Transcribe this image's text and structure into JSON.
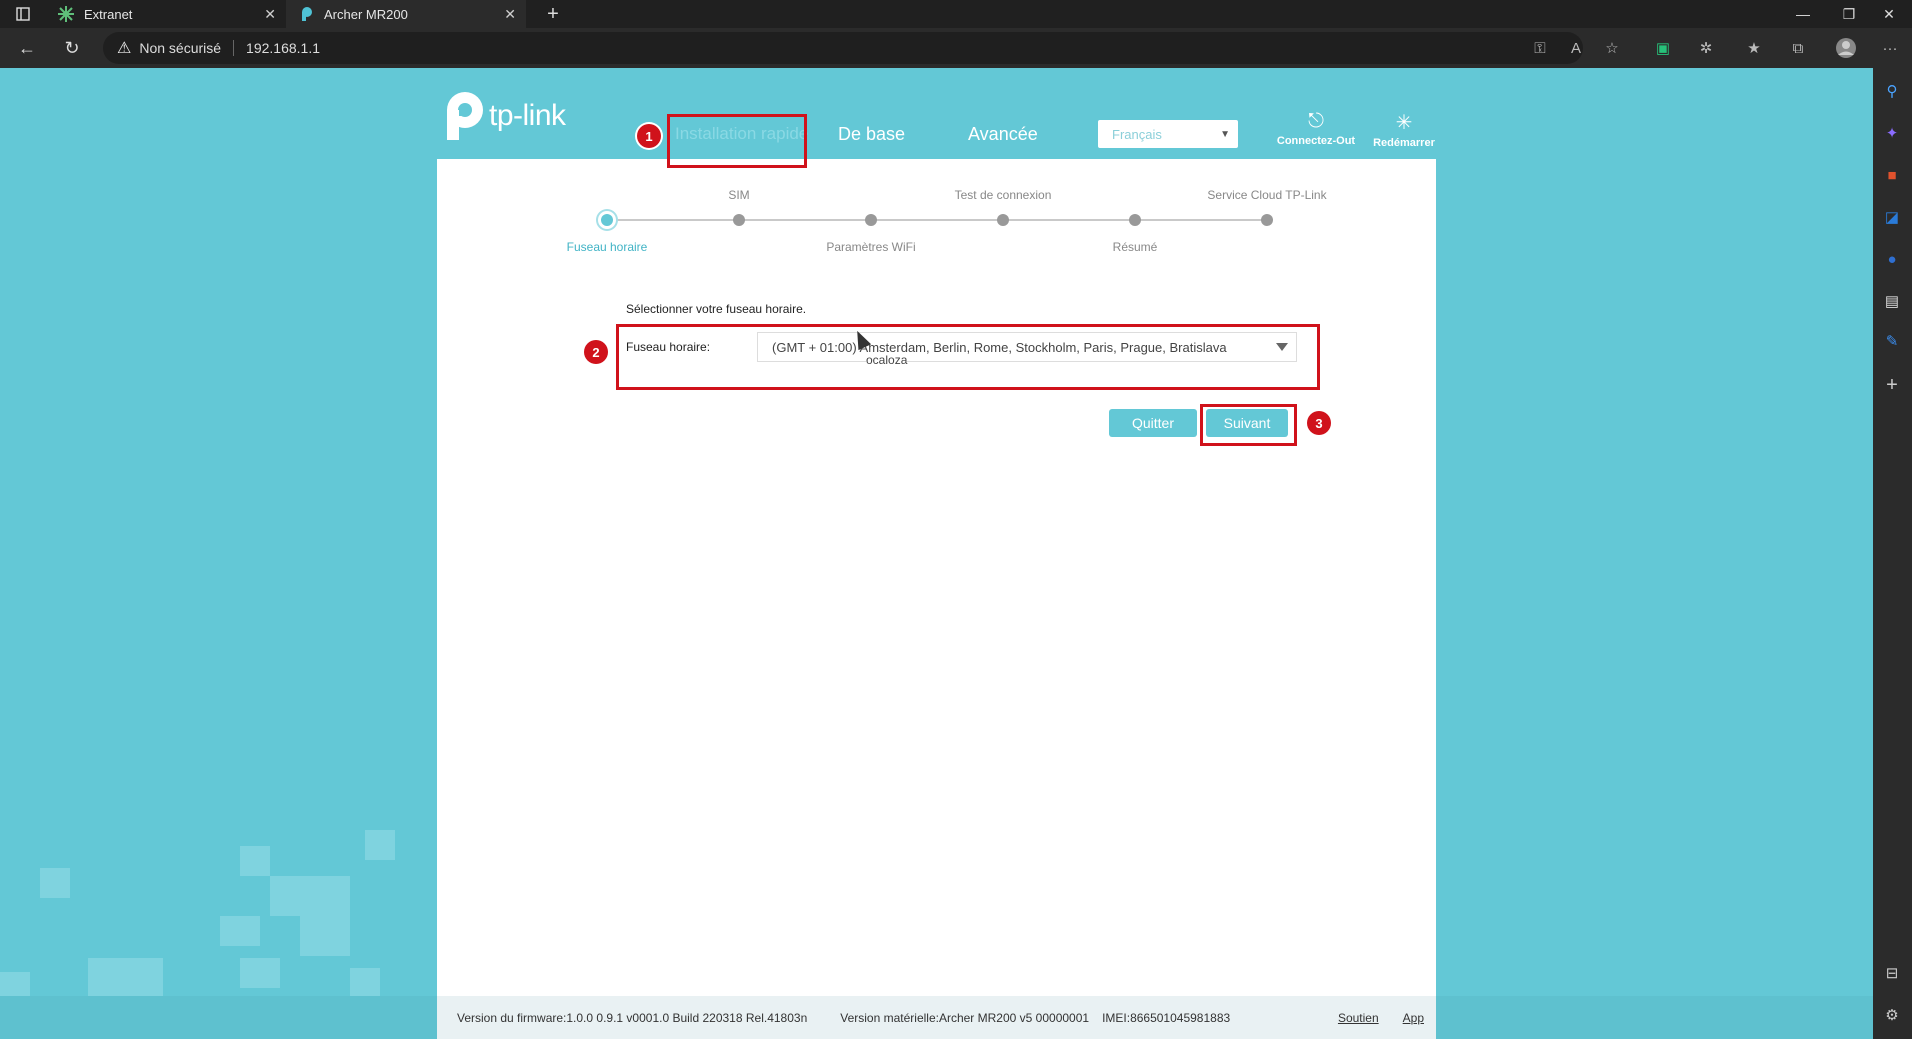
{
  "browser": {
    "tabs": [
      {
        "title": "Extranet"
      },
      {
        "title": "Archer MR200"
      }
    ],
    "security_label": "Non sécurisé",
    "url": "192.168.1.1"
  },
  "router": {
    "brand": "tp-link",
    "nav": {
      "quick_setup": "Installation rapide",
      "basic": "De base",
      "advanced": "Avancée"
    },
    "language": "Français",
    "logout": "Connectez-Out",
    "reboot": "Redémarrer",
    "steps": [
      {
        "label": "Fuseau horaire"
      },
      {
        "label": "SIM"
      },
      {
        "label": "Paramètres WiFi"
      },
      {
        "label": "Test de connexion"
      },
      {
        "label": "Résumé"
      },
      {
        "label": "Service Cloud TP-Link"
      }
    ],
    "active_step": 1,
    "prompt": "Sélectionner votre fuseau horaire.",
    "timezone_label": "Fuseau horaire:",
    "timezone_value": "(GMT + 01:00) Amsterdam, Berlin, Rome, Stockholm, Paris, Prague, Bratislava",
    "tooltip": "ocaloza",
    "quit_button": "Quitter",
    "next_button": "Suivant",
    "footer": {
      "firmware": "Version du firmware:1.0.0 0.9.1 v0001.0 Build 220318 Rel.41803n",
      "hardware": "Version matérielle:Archer MR200 v5 00000001",
      "imei": "IMEI:866501045981883",
      "support": "Soutien",
      "app": "App"
    }
  },
  "annotations": [
    "1",
    "2",
    "3"
  ],
  "colors": {
    "page_bg": "#63c8d6",
    "accent": "#63c8d6",
    "annotation": "#d0121b"
  }
}
